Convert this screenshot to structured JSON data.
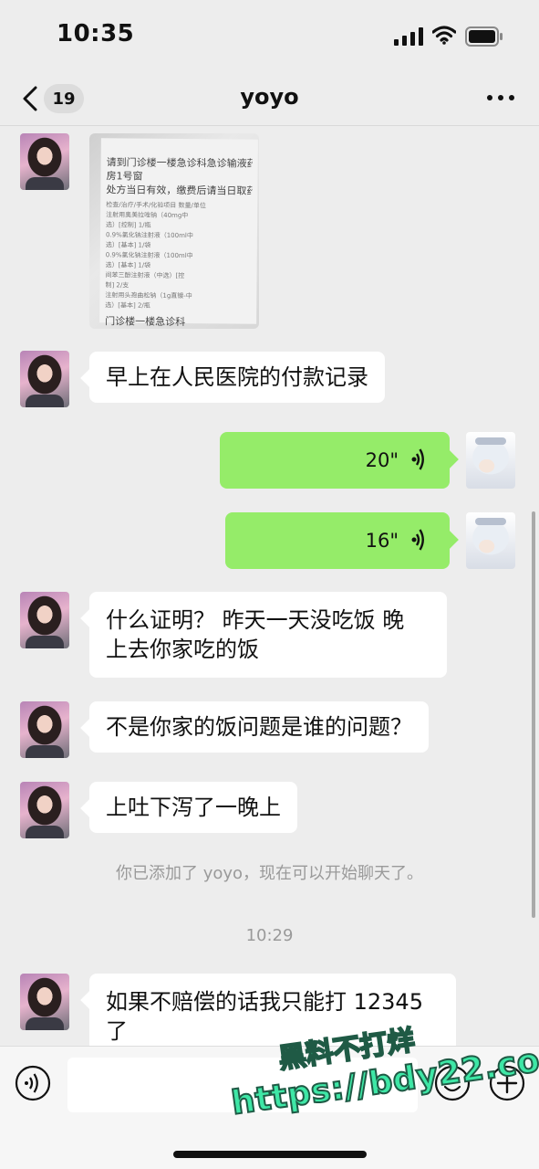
{
  "status_bar": {
    "time": "10:35"
  },
  "nav": {
    "unread_count": "19",
    "title": "yoyo"
  },
  "image_message": {
    "lines": [
      "请到门诊楼一楼急诊科急诊输液药",
      "房1号窗",
      "处方当日有效，缴费后请当日取药",
      "检查/治疗/手术/化验项目        数量/单位",
      "注射用奥美拉唑钠（40mg中",
      "选）[控制]                      1/瓶",
      "0.9%氯化钠注射液（100ml中",
      "选）[基本]                      1/袋",
      "0.9%氯化钠注射液（100ml中",
      "选）[基本]                      1/袋",
      "间苯三酚注射液（中选）[控",
      "制]                             2/支",
      "注射用头孢曲松钠（1g直镀-中",
      "选）[基本]                      2/瓶",
      "门诊楼一楼急诊科"
    ]
  },
  "messages": {
    "m1": "早上在人民医院的付款记录",
    "voice1": "20\"",
    "voice2": "16\"",
    "m2_line1": "什么证明？ 昨天一天没吃饭 晚",
    "m2_line2": "上去你家吃的饭",
    "m3": "不是你家的饭问题是谁的问题？",
    "m4": "上吐下泻了一晚上",
    "system_added": "你已添加了 yoyo，现在可以开始聊天了。",
    "timestamp": "10:29",
    "m5_line1": "如果不赔偿的话我只能打 12345",
    "m5_line2": "了"
  },
  "watermark": {
    "line1": "黑料不打烊",
    "line2": "https://bdy22.co"
  },
  "colors": {
    "background": "#ededed",
    "self_bubble": "#95ec69",
    "other_bubble": "#ffffff",
    "watermark": "#3ee7a6"
  },
  "icons": [
    "back-arrow",
    "more-dots",
    "voice-wave",
    "voice-toggle",
    "emoji",
    "plus",
    "signal",
    "wifi",
    "battery"
  ]
}
